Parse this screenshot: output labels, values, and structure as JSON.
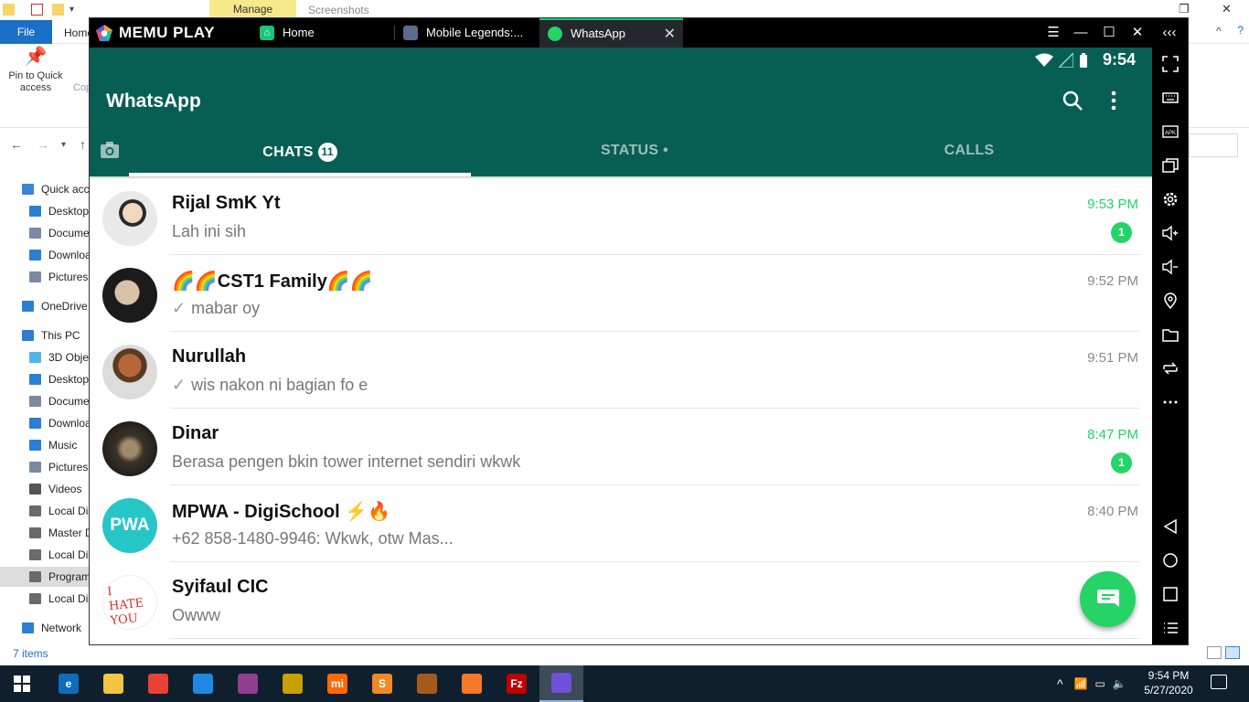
{
  "explorer": {
    "ribbon_contextual_tab": "Manage",
    "window_title": "Screenshots",
    "file_tab": "File",
    "home_tab": "Home",
    "pin_label_line1": "Pin to Quick",
    "pin_label_line2": "access",
    "copy_label": "Cop",
    "nav_items": [
      {
        "label": "Quick acc",
        "icon": "star-icon",
        "color": "#3a86d9"
      },
      {
        "label": "Desktop",
        "icon": "desktop-icon",
        "color": "#2a7fd4"
      },
      {
        "label": "Docume",
        "icon": "document-icon",
        "color": "#7a8aa0"
      },
      {
        "label": "Downloa",
        "icon": "download-icon",
        "color": "#2a7fd4"
      },
      {
        "label": "Pictures",
        "icon": "pictures-icon",
        "color": "#7a8aa0"
      },
      {
        "label": "OneDrive",
        "icon": "cloud-icon",
        "color": "#2a7fd4"
      },
      {
        "label": "This PC",
        "icon": "pc-icon",
        "color": "#2a7fd4"
      },
      {
        "label": "3D Objec",
        "icon": "cube-icon",
        "color": "#4fb6e8"
      },
      {
        "label": "Desktop",
        "icon": "desktop-icon",
        "color": "#2a7fd4"
      },
      {
        "label": "Docume",
        "icon": "document-icon",
        "color": "#7a8aa0"
      },
      {
        "label": "Downloa",
        "icon": "download-icon",
        "color": "#2a7fd4"
      },
      {
        "label": "Music",
        "icon": "music-icon",
        "color": "#2a7fd4"
      },
      {
        "label": "Pictures",
        "icon": "pictures-icon",
        "color": "#7a8aa0"
      },
      {
        "label": "Videos",
        "icon": "video-icon",
        "color": "#555555"
      },
      {
        "label": "Local Dis",
        "icon": "drive-icon",
        "color": "#6a6a6a"
      },
      {
        "label": "Master D",
        "icon": "drive-icon",
        "color": "#6a6a6a"
      },
      {
        "label": "Local Dis",
        "icon": "drive-icon",
        "color": "#6a6a6a"
      },
      {
        "label": "Program",
        "icon": "drive-icon",
        "color": "#6a6a6a"
      },
      {
        "label": "Local Dis",
        "icon": "drive-icon",
        "color": "#6a6a6a"
      },
      {
        "label": "Network",
        "icon": "network-icon",
        "color": "#2a7fd4"
      }
    ],
    "status_items": "7 items"
  },
  "memu": {
    "logo_text": "MEMU PLAY",
    "tabs": [
      {
        "label": "Home",
        "icon": "home-icon",
        "color": "#1bc47d"
      },
      {
        "label": "Mobile Legends:...",
        "icon": "game-icon",
        "color": "#5a6b8c"
      },
      {
        "label": "WhatsApp",
        "icon": "whatsapp-icon",
        "color": "#25d366"
      }
    ]
  },
  "android": {
    "status_time": "9:54"
  },
  "whatsapp": {
    "title": "WhatsApp",
    "tabs": {
      "chats": "CHATS",
      "chats_badge": "11",
      "status": "STATUS",
      "status_dot": "•",
      "calls": "CALLS"
    },
    "colors": {
      "header": "#075e54",
      "accent": "#25d366"
    },
    "chats": [
      {
        "name": "Rijal SmK Yt",
        "message": "Lah ini sih",
        "time": "9:53 PM",
        "unread": "1",
        "tick": false
      },
      {
        "name": "🌈🌈CST1 Family🌈🌈",
        "message": "mabar oy",
        "time": "9:52 PM",
        "unread": "",
        "tick": true
      },
      {
        "name": "Nurullah",
        "message": "wis nakon ni bagian fo e",
        "time": "9:51 PM",
        "unread": "",
        "tick": true
      },
      {
        "name": "Dinar",
        "message": "Berasa pengen bkin tower internet sendiri wkwk",
        "time": "8:47 PM",
        "unread": "1",
        "tick": false
      },
      {
        "name": "MPWA - DigiSchool ⚡🔥",
        "message": "+62 858-1480-9946: Wkwk, otw Mas...",
        "time": "8:40 PM",
        "unread": "",
        "tick": false
      },
      {
        "name": "Syifaul CIC",
        "message": "Owww",
        "time": "",
        "unread": "",
        "tick": false
      }
    ],
    "avatar_texts": {
      "mpwa": "PWA",
      "syifaul": "I HATE YOU"
    }
  },
  "taskbar": {
    "apps": [
      {
        "name": "edge-icon",
        "color": "#0f6cbd",
        "glyph": "e"
      },
      {
        "name": "file-explorer-icon",
        "color": "#f4c542",
        "glyph": ""
      },
      {
        "name": "chrome-icon",
        "color": "#e94235",
        "glyph": ""
      },
      {
        "name": "vscode-icon",
        "color": "#1e88e5",
        "glyph": ""
      },
      {
        "name": "winrar-icon",
        "color": "#8e3f8e",
        "glyph": ""
      },
      {
        "name": "dota-icon",
        "color": "#c9a000",
        "glyph": ""
      },
      {
        "name": "mi-icon",
        "color": "#ff6900",
        "glyph": "mi"
      },
      {
        "name": "sublime-icon",
        "color": "#f08a24",
        "glyph": "S"
      },
      {
        "name": "dota-underlords-icon",
        "color": "#a55a1c",
        "glyph": ""
      },
      {
        "name": "blender-icon",
        "color": "#f5792a",
        "glyph": ""
      },
      {
        "name": "filezilla-icon",
        "color": "#bf0000",
        "glyph": "Fz"
      },
      {
        "name": "memu-icon",
        "color": "#6f52d9",
        "glyph": ""
      }
    ],
    "clock_time": "9:54 PM",
    "clock_date": "5/27/2020"
  }
}
